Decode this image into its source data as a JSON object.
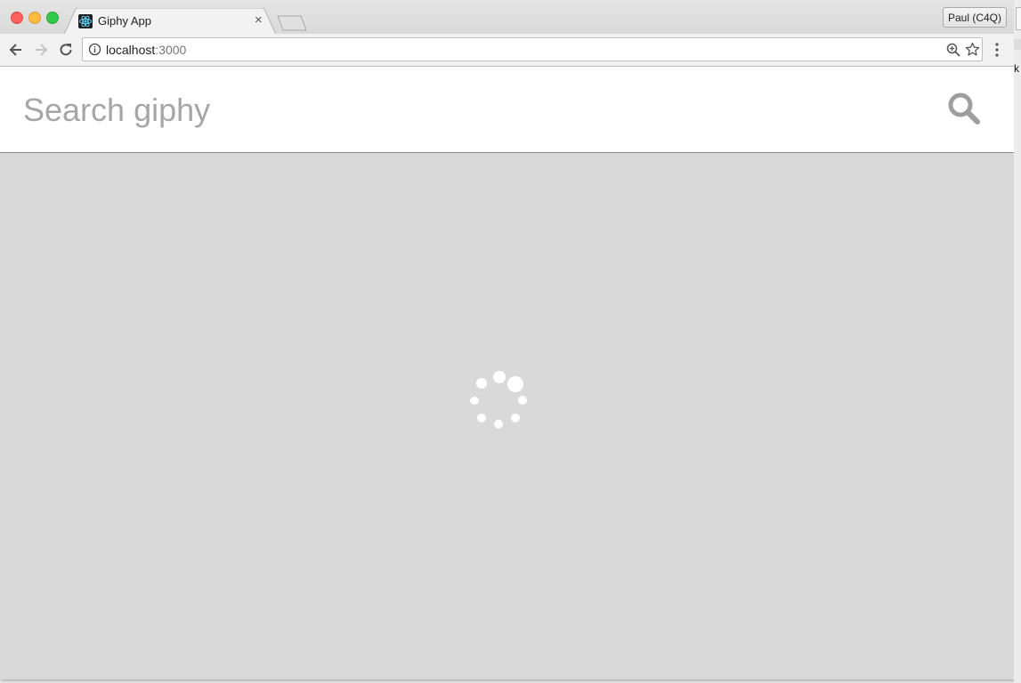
{
  "browser": {
    "tab_title": "Giphy App",
    "tab_close_glyph": "×",
    "profile_label": "Paul (C4Q)",
    "url_host": "localhost",
    "url_port": ":3000",
    "icons": [
      "back-icon",
      "forward-icon",
      "reload-icon",
      "info-icon",
      "zoom-icon",
      "star-icon",
      "menu-icon",
      "react-favicon-icon"
    ]
  },
  "app": {
    "search": {
      "placeholder": "Search giphy",
      "value": ""
    },
    "status": "loading",
    "colors": {
      "content_background": "#d9d9d9",
      "search_bar_background": "#ffffff",
      "search_icon": "#9e9e9e",
      "spinner": "#ffffff"
    }
  },
  "edge_fragment": {
    "text": "k"
  }
}
